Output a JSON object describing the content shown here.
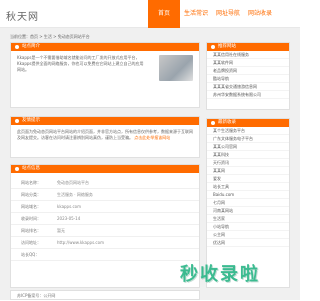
{
  "site": {
    "logo": "秋天网"
  },
  "nav": {
    "items": [
      "首页",
      "生活常识",
      "网址导航",
      "网站收录"
    ],
    "active": 0
  },
  "breadcrumb": "当前位置：首页 > 生活 > 免动态页网站平台",
  "intro": {
    "title": "站点简介",
    "text": "Kkapps是一个不需要借助域名就能访问的工厂发的开放式应用平台，Kkapps提供全面的网络服务，你也可以免费在它网站上建立自己的应用网站。"
  },
  "tips": {
    "title": "友情提示",
    "text": "此页面为免动态页网站平台网站的介绍页面，并非官方站点，所有信息仅供参考，数据来源于互联网及网友提交。访客在访问时请注意辨别网站真伪，谨防上当受骗。",
    "link": "点击此处举报该网站"
  },
  "info": {
    "title": "站点信息",
    "rows": [
      {
        "k": "网站名称：",
        "v": "免动态页网站平台"
      },
      {
        "k": "网站分类：",
        "v": "生活服务 · 网络服务"
      },
      {
        "k": "网站域名：",
        "v": "kkapps.com"
      },
      {
        "k": "收录时间：",
        "v": "2023-05-14"
      },
      {
        "k": "网站排名：",
        "v": "暂无"
      },
      {
        "k": "访问地址：",
        "v": "http://www.kkapps.com"
      },
      {
        "k": "站长QQ：",
        "v": ""
      }
    ]
  },
  "side1": {
    "title": "推荐网站",
    "items": [
      "某某信用社在线服务",
      "某某软件网",
      "老品牌投资网",
      "酷站导航",
      "某某某省交通旅游信息网",
      "苏州华安数据系统有限公司"
    ]
  },
  "side2": {
    "title": "最新收录",
    "items": [
      "某个生活服务平台",
      "广东文体服务电子平台",
      "某某公司官网",
      "某某科技",
      "天行资讯",
      "某某网",
      "爱发",
      "站长工具",
      "Baidu.com",
      "七月网",
      "河南某网站",
      "生活家",
      "小站导航",
      "公主网",
      "优达网"
    ]
  },
  "footer": {
    "text": "苏ICP备案号：公开网"
  },
  "watermark": {
    "text": "秒收录啦"
  },
  "colors": {
    "accent": "#ff6b00",
    "watermark": "#2fb88a"
  }
}
